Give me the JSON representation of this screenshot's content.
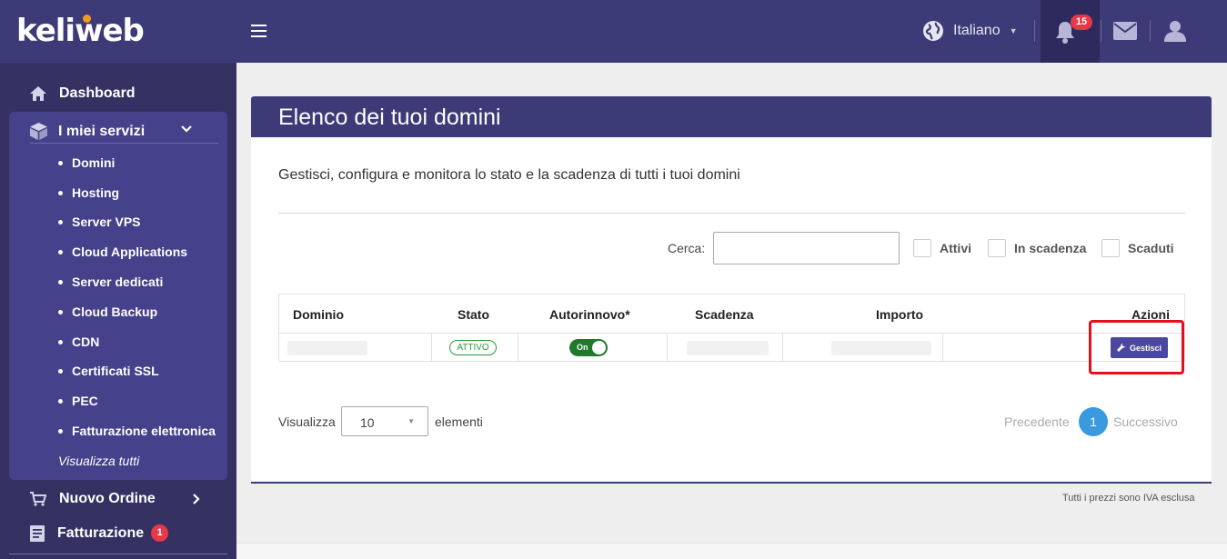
{
  "brand": {
    "logo_text": "keliweb",
    "accent": "#f39a1e",
    "primary": "#3d3a78"
  },
  "header": {
    "language": "Italiano",
    "notifications_count": "15",
    "icons": [
      "globe-icon",
      "bell-icon",
      "mail-icon",
      "user-icon",
      "menu-icon"
    ]
  },
  "sidebar": {
    "dashboard": "Dashboard",
    "services": "I miei servizi",
    "service_items": [
      "Domini",
      "Hosting",
      "Server VPS",
      "Cloud Applications",
      "Server dedicati",
      "Cloud Backup",
      "CDN",
      "Certificati SSL",
      "PEC",
      "Fatturazione elettronica"
    ],
    "view_all": "Visualizza tutti",
    "new_order": "Nuovo Ordine",
    "billing": "Fatturazione",
    "billing_badge": "1"
  },
  "main": {
    "title": "Elenco dei tuoi domini",
    "intro": "Gestisci, configura e monitora lo stato e la scadenza di tutti i tuoi domini",
    "search_label": "Cerca:",
    "search_value": "",
    "filters": [
      "Attivi",
      "In scadenza",
      "Scaduti"
    ],
    "columns": [
      "Dominio",
      "Stato",
      "Autorinnovo*",
      "Scadenza",
      "Importo",
      "Azioni"
    ],
    "row": {
      "status": "ATTIVO",
      "autorenew": "On",
      "action": "Gestisci"
    },
    "show_label": "Visualizza",
    "page_size": "10",
    "elements_label": "elementi",
    "prev": "Precedente",
    "page": "1",
    "next": "Successivo",
    "vat_note": "Tutti i prezzi sono IVA esclusa"
  }
}
